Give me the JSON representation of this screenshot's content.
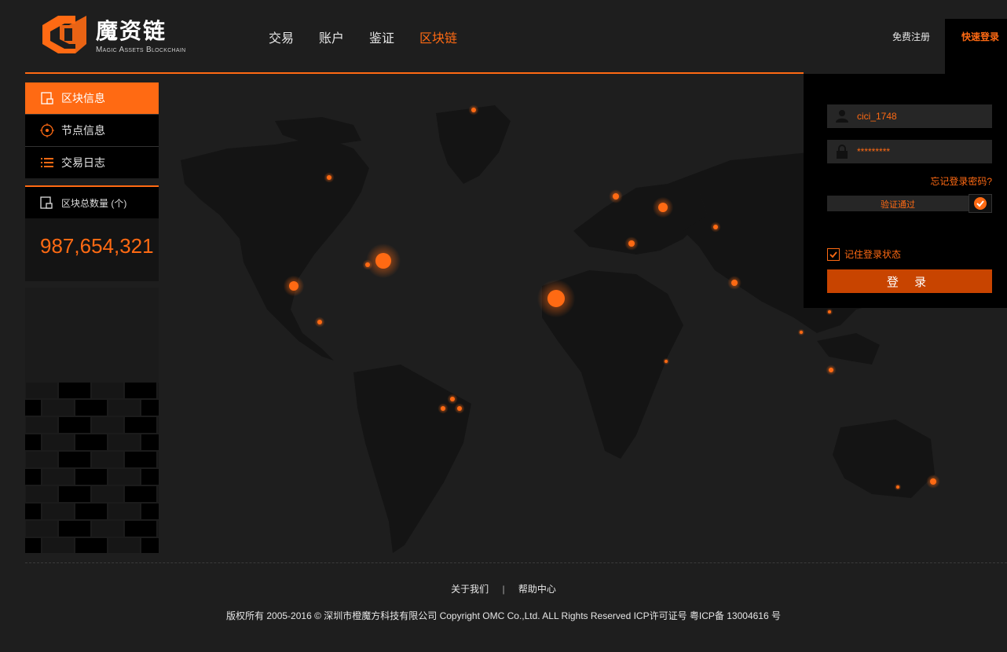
{
  "brand": {
    "name": "魔资链",
    "subtitle": "Magic Assets Blockchain",
    "accent": "#ff6a13"
  },
  "nav": {
    "items": [
      "交易",
      "账户",
      "鉴证",
      "区块链"
    ],
    "active": "区块链"
  },
  "header": {
    "register": "免费注册",
    "quick_login": "快速登录"
  },
  "sidebar": {
    "items": [
      {
        "label": "区块信息",
        "icon": "block-icon",
        "active": true
      },
      {
        "label": "节点信息",
        "icon": "node-icon",
        "active": false
      },
      {
        "label": "交易日志",
        "icon": "list-icon",
        "active": false
      }
    ],
    "count_label": "区块总数量 (个)",
    "count_value": "987,654,321"
  },
  "login": {
    "username": "cici_1748",
    "password": "*********",
    "forgot": "忘记登录密码?",
    "verify": "验证通过",
    "remember": "记住登录状态",
    "button": "登 录"
  },
  "footer": {
    "about": "关于我们",
    "separator": "|",
    "help": "帮助中心",
    "copyright": "版权所有 2005-2016 © 深圳市橙魔方科技有限公司    Copyright OMC Co.,Ltd. ALL Rights Reserved    ICP许可证号 粤ICP备 13004616 号"
  }
}
